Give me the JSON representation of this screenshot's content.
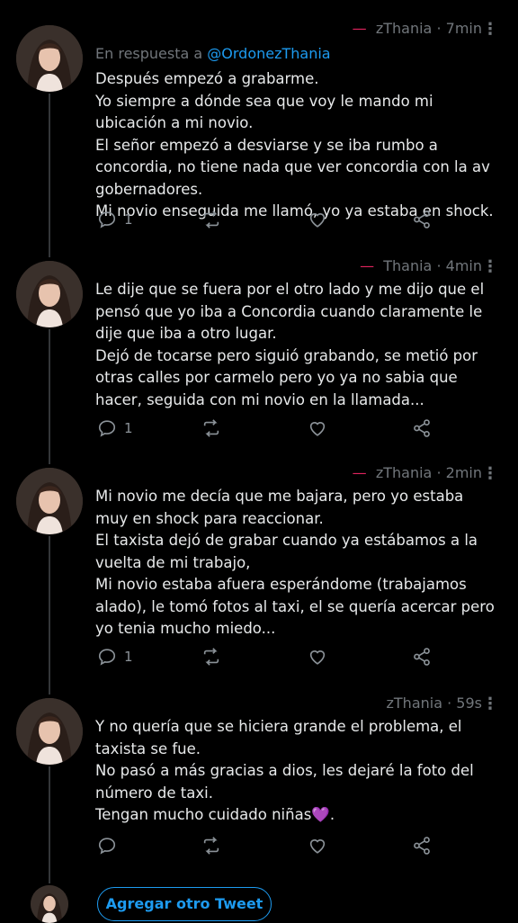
{
  "tweets": [
    {
      "name_fragment": "zThania",
      "time": "7min",
      "reply_label": "En respuesta a",
      "reply_handle": "@OrdonezThania",
      "text": "Después empezó a grabarme.\nYo siempre a dónde sea que voy le mando mi ubicación a mi novio.\nEl señor empezó a desviarse y se iba rumbo a concordia, no tiene nada que ver concordia con la av gobernadores.\nMi novio enseguida me llamó, yo ya estaba en shock.",
      "reply_count": "1"
    },
    {
      "name_fragment": "Thania",
      "time": "4min",
      "text": "Le dije que se fuera por el otro lado y me dijo que el pensó que yo iba a Concordia cuando claramente le dije que iba a otro lugar.\nDejó de tocarse pero siguió grabando, se metió por otras calles por carmelo pero yo ya no sabia que hacer, seguida con mi novio en la llamada...",
      "reply_count": "1"
    },
    {
      "name_fragment": "zThania",
      "time": "2min",
      "text": "Mi novio me decía que me bajara, pero yo estaba muy en shock para reaccionar.\nEl taxista dejó de grabar cuando ya estábamos a la vuelta de mi trabajo,\nMi novio estaba afuera esperándome (trabajamos alado), le tomó fotos al taxi, el se quería acercar pero yo tenia mucho miedo...",
      "reply_count": "1"
    },
    {
      "name_fragment": "zThania",
      "time": "59s",
      "text": "Y no quería que se hiciera grande el problema, el taxista se fue.\nNo pasó a más gracias a dios, les dejaré la foto del número de taxi.\nTengan mucho cuidado niñas💜.",
      "reply_count": ""
    }
  ],
  "separator": "·",
  "add_tweet_label": "Agregar otro Tweet",
  "icons": {
    "reply": "reply-icon",
    "retweet": "retweet-icon",
    "like": "heart-icon",
    "share": "share-icon",
    "more": "more-icon"
  },
  "colors": {
    "background": "#000000",
    "text": "#e7e9ea",
    "muted": "#71767b",
    "accent": "#1d9bf0"
  }
}
